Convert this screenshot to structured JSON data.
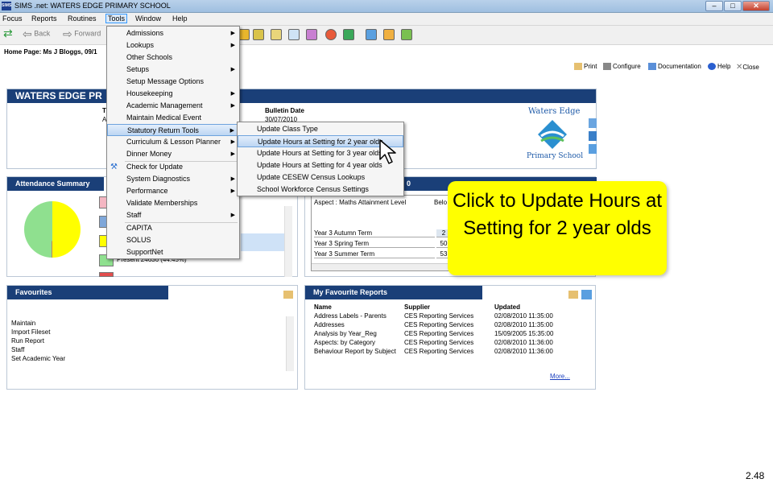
{
  "window": {
    "title": "SIMS .net: WATERS EDGE PRIMARY SCHOOL",
    "icon_text": "SIMS",
    "minimize": "–",
    "maximize": "□",
    "close": "✕"
  },
  "menubar": [
    "Focus",
    "Reports",
    "Routines",
    "Tools",
    "Window",
    "Help"
  ],
  "toolbar": {
    "back": "Back",
    "forward": "Forward"
  },
  "home": {
    "label": "Home Page: Ms J Bloggs, 09/1",
    "actions": [
      "Print",
      "Configure",
      "Documentation",
      "Help",
      "Close"
    ]
  },
  "banner": {
    "title": "WATERS EDGE PR",
    "bulletin_header": "Bulletin Date",
    "bulletin_date": "30/07/2010",
    "logo_line1": "Waters Edge",
    "logo_line2": "Primary School",
    "fragment_1": "T",
    "fragment_2": "A"
  },
  "attendance": {
    "title": "Attendance Summary",
    "present": "Present 24636 (44.45%)",
    "swatches": [
      "#f4b6c2",
      "#7fa7d9",
      "#ffff00",
      "#8fe08f",
      "#e34d4d"
    ]
  },
  "aspect": {
    "title": "0",
    "header": "Aspect : Maths Attainment Level",
    "col2": "Belo",
    "rows": [
      {
        "label": "Year 3 Autumn Term",
        "value": "2"
      },
      {
        "label": "Year 3 Spring Term",
        "value": "50"
      },
      {
        "label": "Year 3 Summer Term",
        "value": "53"
      }
    ]
  },
  "favourites": {
    "title": "Favourites",
    "items": [
      "Maintain",
      "Import Fileset",
      "Run Report",
      "Staff",
      "Set Academic Year"
    ]
  },
  "my_reports": {
    "title": "My Favourite Reports",
    "headers": [
      "Name",
      "Supplier",
      "Updated"
    ],
    "rows": [
      [
        "Address Labels - Parents",
        "CES Reporting Services",
        "02/08/2010 11:35:00"
      ],
      [
        "Addresses",
        "CES Reporting Services",
        "02/08/2010 11:35:00"
      ],
      [
        "Analysis by Year_Reg",
        "CES Reporting Services",
        "15/09/2005 15:35:00"
      ],
      [
        "Aspects: by Category",
        "CES Reporting Services",
        "02/08/2010 11:36:00"
      ],
      [
        "Behaviour Report by Subject",
        "CES Reporting Services",
        "02/08/2010 11:36:00"
      ]
    ],
    "more": "More..."
  },
  "tools_menu": {
    "items": [
      {
        "label": "Admissions",
        "submenu": true
      },
      {
        "label": "Lookups",
        "submenu": true
      },
      {
        "label": "Other Schools",
        "submenu": false
      },
      {
        "label": "Setups",
        "submenu": true
      },
      {
        "label": "Setup Message Options",
        "submenu": false
      },
      {
        "label": "Housekeeping",
        "submenu": true
      },
      {
        "label": "Academic Management",
        "submenu": true
      },
      {
        "label": "Maintain Medical Event",
        "submenu": false
      },
      {
        "label": "Statutory Return Tools",
        "submenu": true
      },
      {
        "label": "Curriculum & Lesson Planner",
        "submenu": true
      },
      {
        "label": "Dinner Money",
        "submenu": true
      },
      {
        "label": "Check for Update",
        "submenu": false
      },
      {
        "label": "System Diagnostics",
        "submenu": true
      },
      {
        "label": "Performance",
        "submenu": true
      },
      {
        "label": "Validate Memberships",
        "submenu": false
      },
      {
        "label": "Staff",
        "submenu": true
      },
      {
        "label": "CAPITA",
        "submenu": false
      },
      {
        "label": "SOLUS",
        "submenu": false
      },
      {
        "label": "SupportNet",
        "submenu": false
      }
    ],
    "highlighted": "Statutory Return Tools"
  },
  "statutory_submenu": {
    "items": [
      "Update Class Type",
      "Update Hours at Setting for 2 year olds",
      "Update Hours at Setting for 3 year olds",
      "Update Hours at Setting for 4 year olds",
      "Update CESEW Census Lookups",
      "School Workforce Census Settings"
    ],
    "highlighted": "Update Hours at Setting for 2 year olds"
  },
  "callout": {
    "text": "Click to Update Hours at Setting for 2 year olds"
  },
  "slide_number": "2.48",
  "colors": {
    "accent": "#1a3f78",
    "callout": "#ffff00",
    "highlight": "#bcd6f3"
  }
}
